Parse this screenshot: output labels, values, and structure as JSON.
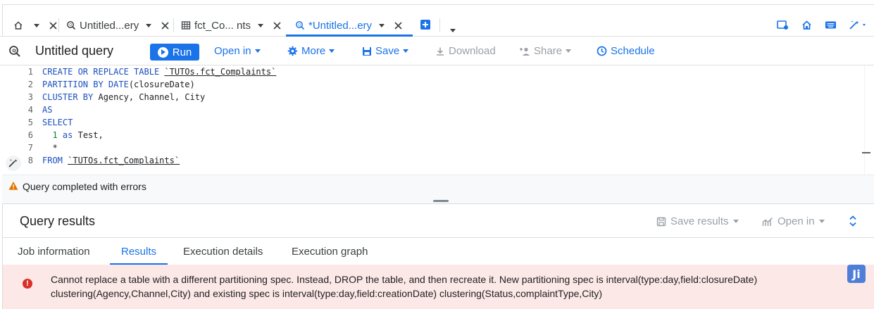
{
  "tabs": [
    {
      "label": "",
      "icon": "home-icon"
    },
    {
      "label": "Untitled...ery",
      "icon": "query-icon"
    },
    {
      "label": "fct_Co...  nts",
      "icon": "table-icon"
    },
    {
      "label": "*Untitled...ery",
      "icon": "query-icon",
      "active": true
    }
  ],
  "toolbar": {
    "title": "Untitled query",
    "run_label": "Run",
    "open_in_label": "Open in",
    "more_label": "More",
    "save_label": "Save",
    "download_label": "Download",
    "share_label": "Share",
    "schedule_label": "Schedule"
  },
  "editor": {
    "lines": [
      {
        "n": "1"
      },
      {
        "n": "2"
      },
      {
        "n": "3"
      },
      {
        "n": "4"
      },
      {
        "n": "5"
      },
      {
        "n": "6"
      },
      {
        "n": "7"
      },
      {
        "n": "8"
      }
    ],
    "tokens": {
      "l1_kw": "CREATE OR REPLACE TABLE ",
      "l1_tbl": "`TUTOs.fct_Complaints`",
      "l2_kw": "PARTITION BY DATE",
      "l2_rest": "(closureDate)",
      "l3_kw": "CLUSTER BY ",
      "l3_rest": "Agency, Channel, City",
      "l4_kw": "AS",
      "l5_kw": "SELECT",
      "l6_num": "1",
      "l6_kw": " as ",
      "l6_rest": "Test,",
      "l7_rest": "*",
      "l8_kw": "FROM ",
      "l8_tbl": "`TUTOs.fct_Complaints`"
    }
  },
  "status": {
    "message": "Query completed with errors"
  },
  "results": {
    "title": "Query results",
    "save_results_label": "Save results",
    "open_in_label": "Open in",
    "tabs": {
      "job_information": "Job information",
      "results": "Results",
      "execution_details": "Execution details",
      "execution_graph": "Execution graph"
    },
    "error_text": "Cannot replace a table with a different partitioning spec. Instead, DROP the table, and then recreate it. New partitioning spec is interval(type:day,field:closureDate) clustering(Agency,Channel,City) and existing spec is interval(type:day,field:creationDate) clustering(Status,complaintType,City)",
    "badge": "Ji"
  },
  "colors": {
    "accent": "#1a73e8",
    "error_bg": "#fce8e6",
    "error_icon": "#d93025",
    "warning": "#e37400"
  }
}
